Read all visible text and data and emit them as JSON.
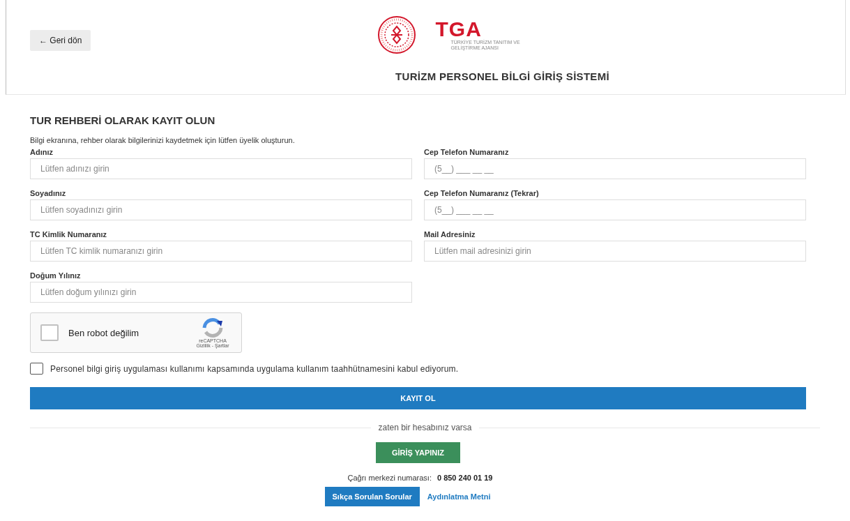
{
  "header": {
    "back_button": "← Geri dön",
    "logo_text": "TGA",
    "logo_tagline": "TÜRKİYE TURİZM TANITIM VE GELİŞTİRME AJANSI",
    "title": "TURİZM PERSONEL BİLGİ GİRİŞ SİSTEMİ"
  },
  "form": {
    "heading": "TUR REHBERİ OLARAK KAYIT OLUN",
    "intro": "Bilgi ekranına, rehber olarak bilgilerinizi kaydetmek için lütfen üyelik oluşturun.",
    "left_fields": [
      {
        "label": "Adınız",
        "placeholder": "Lütfen adınızı girin"
      },
      {
        "label": "Soyadınız",
        "placeholder": "Lütfen soyadınızı girin"
      },
      {
        "label": "TC Kimlik Numaranız",
        "placeholder": "Lütfen TC kimlik numaranızı girin"
      },
      {
        "label": "Doğum Yılınız",
        "placeholder": "Lütfen doğum yılınızı girin"
      }
    ],
    "right_fields": [
      {
        "label": "Cep Telefon Numaranız",
        "placeholder": "(5__) ___ __ __"
      },
      {
        "label": "Cep Telefon Numaranız (Tekrar)",
        "placeholder": "(5__) ___ __ __"
      },
      {
        "label": "Mail Adresiniz",
        "placeholder": "Lütfen mail adresinizi girin"
      }
    ],
    "captcha": {
      "label": "Ben robot değilim",
      "checked": false,
      "brand": "reCAPTCHA",
      "links": "Gizlilik - Şartlar"
    },
    "consent": {
      "label": "Personel bilgi giriş uygulaması kullanımı kapsamında uygulama kullanım taahhütnamesini kabul ediyorum.",
      "checked": false
    },
    "submit": "KAYIT OL",
    "divider_text": "zaten bir hesabınız varsa",
    "login_button": "GİRİŞ YAPINIZ",
    "call_center_label": "Çağrı merkezi numarası:",
    "call_center_number": "0 850 240 01 19",
    "faq_button": "Sıkça Sorulan Sorular",
    "disclosure_link": "Aydınlatma Metni"
  }
}
